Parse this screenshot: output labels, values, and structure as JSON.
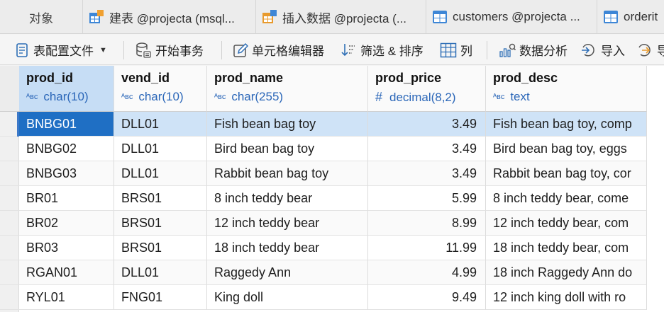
{
  "tabs": [
    {
      "label": "对象",
      "icon": "none"
    },
    {
      "label": "建表 @projecta (msql...",
      "icon": "table-design-icon"
    },
    {
      "label": "插入数据 @projecta (...",
      "icon": "query-icon"
    },
    {
      "label": "customers @projecta ...",
      "icon": "table-icon"
    },
    {
      "label": "orderit",
      "icon": "table-icon"
    }
  ],
  "toolbar": {
    "config_file": "表配置文件",
    "begin_transaction": "开始事务",
    "cell_editor": "单元格编辑器",
    "filter_sort": "筛选 & 排序",
    "columns": "列",
    "data_analysis": "数据分析",
    "import": "导入",
    "export_partial": "导"
  },
  "columns": [
    {
      "name": "prod_id",
      "type": "char(10)",
      "type_icon": "text-type-icon"
    },
    {
      "name": "vend_id",
      "type": "char(10)",
      "type_icon": "text-type-icon"
    },
    {
      "name": "prod_name",
      "type": "char(255)",
      "type_icon": "text-type-icon"
    },
    {
      "name": "prod_price",
      "type": "decimal(8,2)",
      "type_icon": "number-type-icon"
    },
    {
      "name": "prod_desc",
      "type": "text",
      "type_icon": "text-type-icon"
    }
  ],
  "rows": [
    [
      "BNBG01",
      "DLL01",
      "Fish bean bag toy",
      "3.49",
      "Fish bean bag toy, comp"
    ],
    [
      "BNBG02",
      "DLL01",
      "Bird bean bag toy",
      "3.49",
      "Bird bean bag toy, eggs"
    ],
    [
      "BNBG03",
      "DLL01",
      "Rabbit bean bag toy",
      "3.49",
      "Rabbit bean bag toy, cor"
    ],
    [
      "BR01",
      "BRS01",
      "8 inch teddy bear",
      "5.99",
      "8 inch teddy bear, come"
    ],
    [
      "BR02",
      "BRS01",
      "12 inch teddy bear",
      "8.99",
      "12 inch teddy bear, com"
    ],
    [
      "BR03",
      "BRS01",
      "18 inch teddy bear",
      "11.99",
      "18 inch teddy bear, com"
    ],
    [
      "RGAN01",
      "DLL01",
      "Raggedy Ann",
      "4.99",
      "18 inch Raggedy Ann do"
    ],
    [
      "RYL01",
      "FNG01",
      "King doll",
      "9.49",
      "12 inch king doll with ro"
    ]
  ],
  "selection": {
    "row": 0,
    "column": 0
  },
  "colors": {
    "accent": "#1f6fc4",
    "selected_row": "#cfe3f7",
    "header_active": "#c6ddf5",
    "type_text": "#2a66b8"
  }
}
